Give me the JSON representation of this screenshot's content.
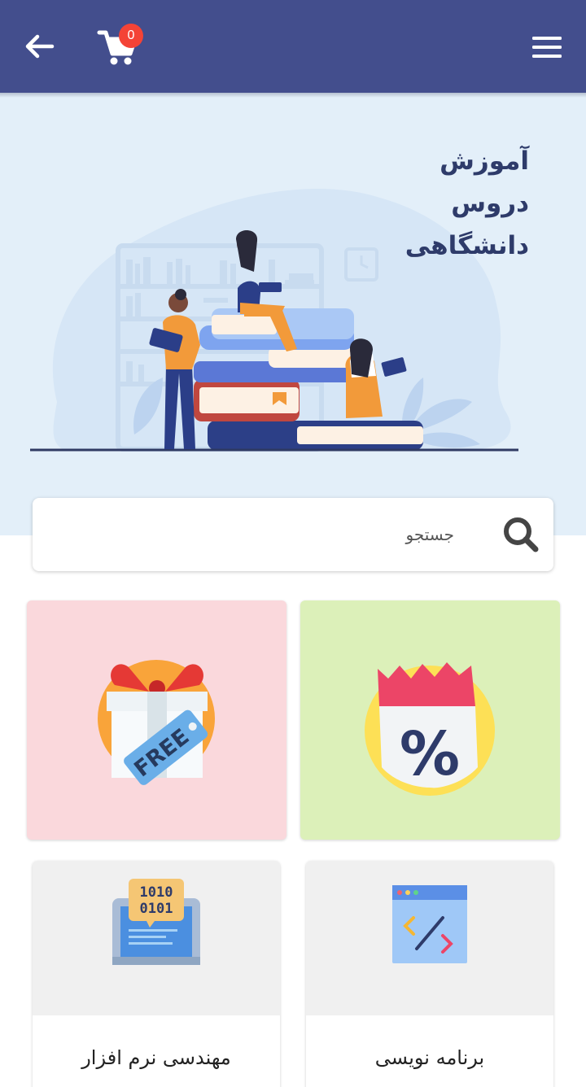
{
  "header": {
    "cart_count": "0"
  },
  "hero": {
    "title_lines": [
      "آموزش",
      "دروس",
      "دانشگاهی"
    ]
  },
  "search": {
    "placeholder": "جستجو"
  },
  "promos": {
    "free_tag": "FREE",
    "discount_symbol": "%"
  },
  "categories": [
    {
      "label": "مهندسی نرم افزار",
      "icon": "binary-laptop-icon",
      "code_line1": "1010",
      "code_line2": "0101"
    },
    {
      "label": "برنامه نویسی",
      "icon": "code-window-icon"
    }
  ],
  "colors": {
    "header_bg": "#434e8d",
    "hero_bg": "#e3eff9",
    "badge": "#f44336",
    "promo_free_bg": "#fad8dc",
    "promo_discount_bg": "#dcf0b9"
  }
}
